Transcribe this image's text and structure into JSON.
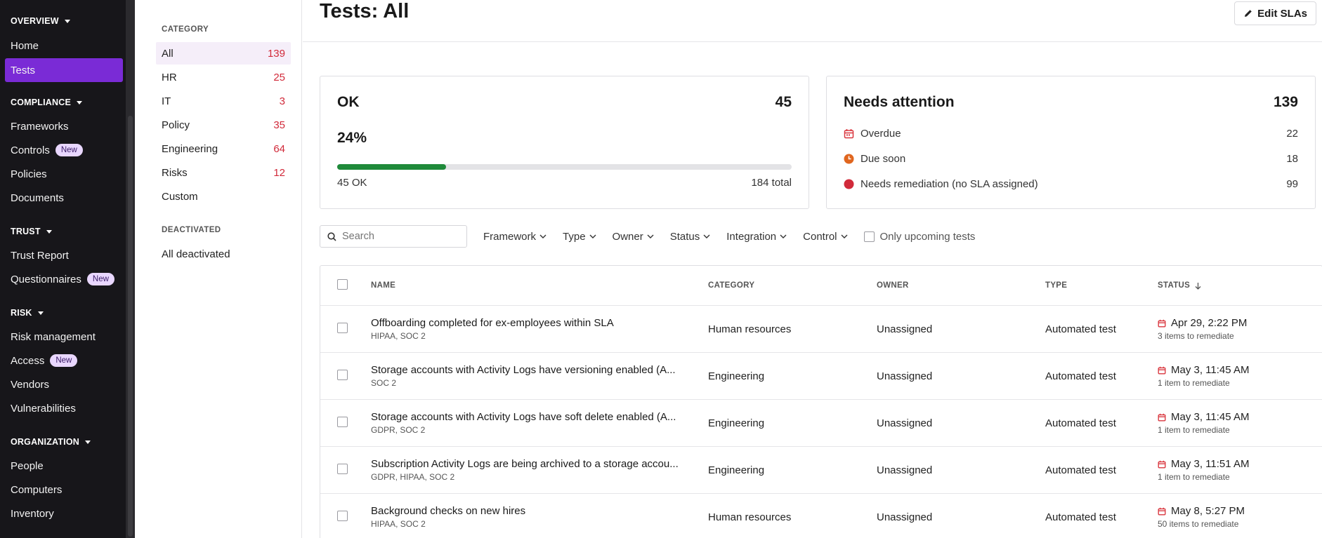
{
  "sidebar": {
    "sections": [
      {
        "heading": "OVERVIEW",
        "items": [
          {
            "label": "Home"
          },
          {
            "label": "Tests",
            "active": true
          }
        ]
      },
      {
        "heading": "COMPLIANCE",
        "items": [
          {
            "label": "Frameworks"
          },
          {
            "label": "Controls",
            "badge": "New"
          },
          {
            "label": "Policies"
          },
          {
            "label": "Documents"
          }
        ]
      },
      {
        "heading": "TRUST",
        "items": [
          {
            "label": "Trust Report"
          },
          {
            "label": "Questionnaires",
            "badge": "New"
          }
        ]
      },
      {
        "heading": "RISK",
        "items": [
          {
            "label": "Risk management"
          },
          {
            "label": "Access",
            "badge": "New"
          },
          {
            "label": "Vendors"
          },
          {
            "label": "Vulnerabilities"
          }
        ]
      },
      {
        "heading": "ORGANIZATION",
        "items": [
          {
            "label": "People"
          },
          {
            "label": "Computers"
          },
          {
            "label": "Inventory"
          }
        ]
      }
    ]
  },
  "categories": {
    "heading": "CATEGORY",
    "items": [
      {
        "label": "All",
        "count": "139"
      },
      {
        "label": "HR",
        "count": "25"
      },
      {
        "label": "IT",
        "count": "3"
      },
      {
        "label": "Policy",
        "count": "35"
      },
      {
        "label": "Engineering",
        "count": "64"
      },
      {
        "label": "Risks",
        "count": "12"
      },
      {
        "label": "Custom",
        "count": ""
      }
    ],
    "deactivated_heading": "DEACTIVATED",
    "deactivated_item": "All deactivated"
  },
  "header": {
    "title": "Tests: All",
    "edit_label": "Edit SLAs"
  },
  "ok_card": {
    "title": "OK",
    "count": "45",
    "percent_label": "24%",
    "progress": 0.24,
    "ok_label": "45 OK",
    "total_label": "184 total",
    "fill_color": "#1f8a3a"
  },
  "attention_card": {
    "title": "Needs attention",
    "count": "139",
    "rows": [
      {
        "label": "Overdue",
        "count": "22",
        "icon": "calendar-icon",
        "color": "#d9363e"
      },
      {
        "label": "Due soon",
        "count": "18",
        "icon": "clock-icon",
        "color": "#e0661f"
      },
      {
        "label": "Needs remediation (no SLA assigned)",
        "count": "99",
        "icon": "red-dot-icon",
        "color": "#d12a3a"
      }
    ]
  },
  "filters": {
    "search_placeholder": "Search",
    "dropdowns": [
      "Framework",
      "Type",
      "Owner",
      "Status",
      "Integration",
      "Control"
    ],
    "only_upcoming_label": "Only upcoming tests"
  },
  "table": {
    "columns": {
      "name": "NAME",
      "category": "CATEGORY",
      "owner": "OWNER",
      "type": "TYPE",
      "status": "STATUS"
    },
    "rows": [
      {
        "name": "Offboarding completed for ex-employees within SLA",
        "frameworks": "HIPAA, SOC 2",
        "category": "Human resources",
        "owner": "Unassigned",
        "type": "Automated test",
        "status": "Apr 29, 2:22 PM",
        "status_sub": "3 items to remediate"
      },
      {
        "name": "Storage accounts with Activity Logs have versioning enabled (A...",
        "frameworks": "SOC 2",
        "category": "Engineering",
        "owner": "Unassigned",
        "type": "Automated test",
        "status": "May 3, 11:45 AM",
        "status_sub": "1 item to remediate"
      },
      {
        "name": "Storage accounts with Activity Logs have soft delete enabled (A...",
        "frameworks": "GDPR, SOC 2",
        "category": "Engineering",
        "owner": "Unassigned",
        "type": "Automated test",
        "status": "May 3, 11:45 AM",
        "status_sub": "1 item to remediate"
      },
      {
        "name": "Subscription Activity Logs are being archived to a storage accou...",
        "frameworks": "GDPR, HIPAA, SOC 2",
        "category": "Engineering",
        "owner": "Unassigned",
        "type": "Automated test",
        "status": "May 3, 11:51 AM",
        "status_sub": "1 item to remediate"
      },
      {
        "name": "Background checks on new hires",
        "frameworks": "HIPAA, SOC 2",
        "category": "Human resources",
        "owner": "Unassigned",
        "type": "Automated test",
        "status": "May 8, 5:27 PM",
        "status_sub": "50 items to remediate"
      }
    ]
  }
}
